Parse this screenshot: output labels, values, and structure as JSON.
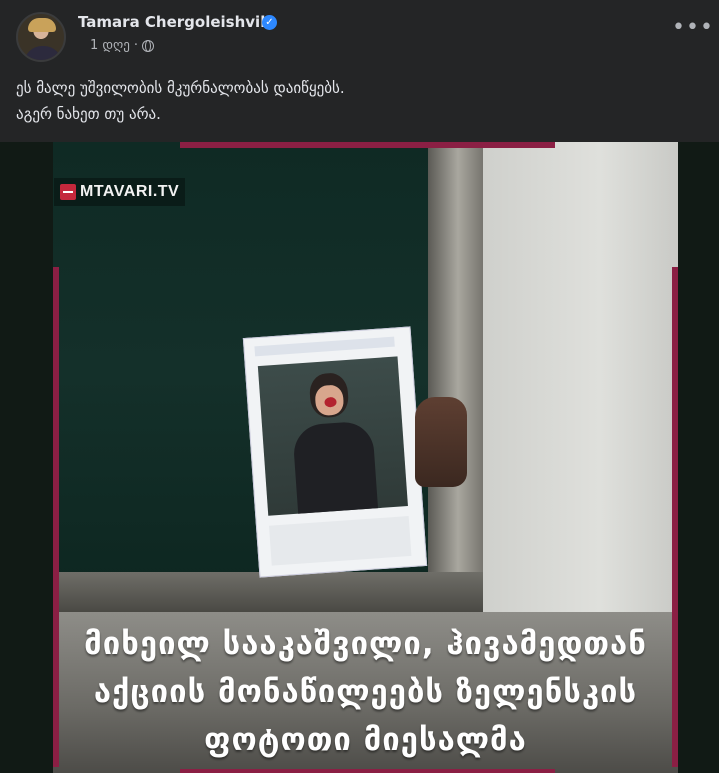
{
  "post": {
    "author": "Tamara Chergoleishvili",
    "verified_icon": "verified-badge-icon",
    "time": "1 დღე",
    "separator": "·",
    "privacy_icon": "globe-icon",
    "more_icon": "more-options-icon",
    "more_label": "•••",
    "text_lines": [
      "ეს მალე უშვილობის მკურნალობას დაიწყებს.",
      "აგერ ნახეთ თუ არა."
    ]
  },
  "media": {
    "logo_text": "MTAVARI.TV",
    "caption_lines": [
      "მიხეილ სააკაშვილი, ჰივამედთან",
      "აქციის მონაწილეებს ზელენსკის",
      "ფოტოთი მიესალმა"
    ],
    "accent_color": "#8b1f44"
  }
}
